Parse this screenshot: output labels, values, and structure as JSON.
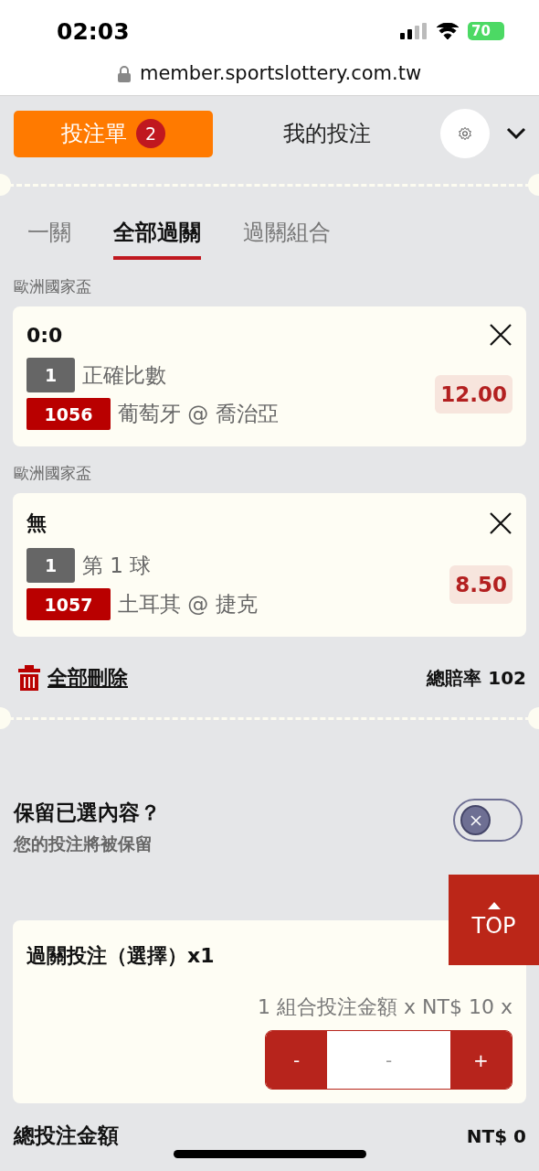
{
  "status_bar": {
    "time": "02:03",
    "battery": "70"
  },
  "browser": {
    "url": "member.sportslottery.com.tw"
  },
  "header": {
    "betslip_label": "投注單",
    "betslip_count": "2",
    "my_bets_label": "我的投注"
  },
  "tabs": [
    {
      "label": "一關",
      "selected": false
    },
    {
      "label": "全部過關",
      "selected": true
    },
    {
      "label": "過關組合",
      "selected": false
    }
  ],
  "selections": [
    {
      "league": "歐洲國家盃",
      "pick": "0:0",
      "line_no": "1",
      "market": "正確比數",
      "match_no": "1056",
      "match": "葡萄牙 @ 喬治亞",
      "odds": "12.00"
    },
    {
      "league": "歐洲國家盃",
      "pick": "無",
      "line_no": "1",
      "market": "第 1 球",
      "match_no": "1057",
      "match": "土耳其 @ 捷克",
      "odds": "8.50"
    }
  ],
  "delete_all": "全部刪除",
  "total_odds_label": "總賠率",
  "total_odds": "102",
  "keep_selection": {
    "title": "保留已選內容？",
    "subtitle": "您的投注將被保留",
    "on": false
  },
  "top_button": "TOP",
  "parlay": {
    "title": "過關投注（選擇）x1",
    "formula": "1 組合投注金額 x NT$ 10 x",
    "minus": "-",
    "plus": "+",
    "placeholder": "-"
  },
  "total_stake_label": "總投注金額",
  "total_stake": "NT$ 0"
}
